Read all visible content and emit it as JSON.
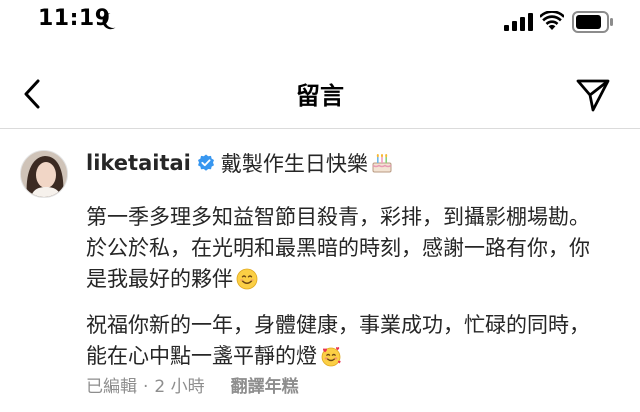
{
  "status_bar": {
    "time": "11:19",
    "icons": [
      "moon-icon",
      "cellular-signal-icon",
      "wifi-icon",
      "battery-icon"
    ]
  },
  "nav": {
    "title": "留言",
    "back_icon": "chevron-left-icon",
    "send_icon": "send-icon"
  },
  "comment": {
    "username": "liketaitai",
    "verified": true,
    "header_text": "戴製作生日快樂",
    "header_emoji": "birthday-cake",
    "paragraph1_lines": [
      "第一季多理多知益智節目殺青，彩排，到攝影棚場勘。",
      "於公於私，在光明和最黑暗的時刻，感謝一路有你，你",
      "是我最好的夥伴"
    ],
    "paragraph1_emoji": "smiling-face",
    "paragraph2_lines": [
      "祝福你新的一年，身體健康，事業成功，忙碌的同時，",
      "能在心中點一盞平靜的燈"
    ],
    "paragraph2_emoji": "smiling-face-with-hearts",
    "edited_label": "已編輯",
    "separator": "·",
    "time_ago": "2 小時",
    "translate_label": "翻譯年糕"
  },
  "colors": {
    "text": "#262626",
    "secondary": "#8e8e8e",
    "verified_blue": "#3897f0",
    "divider": "#dbdbdb"
  }
}
